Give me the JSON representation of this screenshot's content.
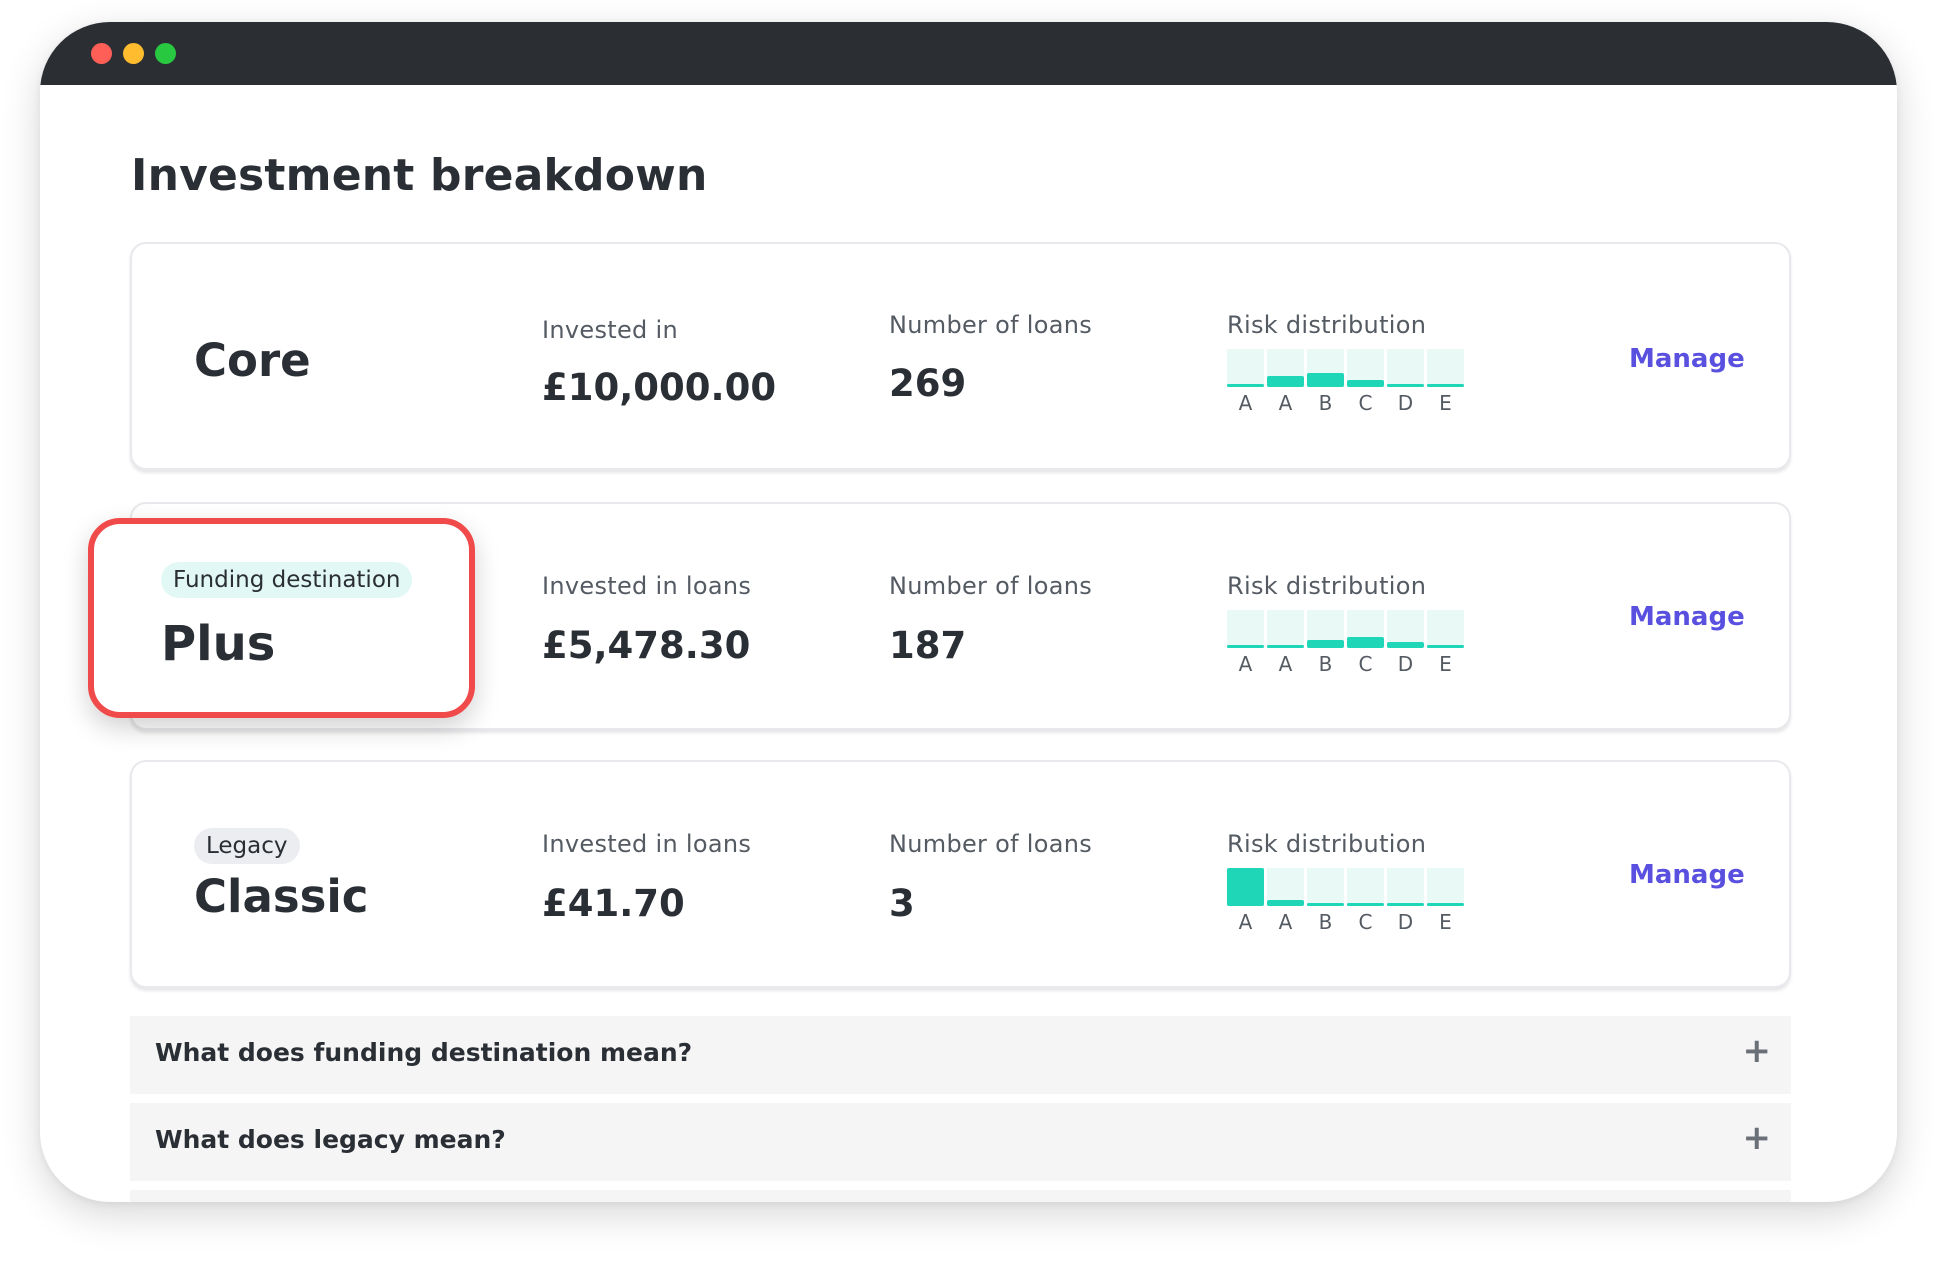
{
  "window": {
    "controls": [
      {
        "name": "close",
        "color": "#ff5f57"
      },
      {
        "name": "minimize",
        "color": "#febc2e"
      },
      {
        "name": "maximize",
        "color": "#28c840"
      }
    ]
  },
  "page": {
    "title": "Investment breakdown"
  },
  "risk_letters": [
    "A",
    "A",
    "B",
    "C",
    "D",
    "E"
  ],
  "accent_color": "#1fd6b7",
  "link_color": "#5a50e0",
  "highlight_color": "#f14a4a",
  "products": [
    {
      "name": "Core",
      "badge": "",
      "invested_label": "Invested in",
      "invested_value": "£10,000.00",
      "loans_label": "Number of loans",
      "loans_value": "269",
      "risk_title": "Risk distribution",
      "risk_levels": [
        0.05,
        0.28,
        0.36,
        0.18,
        0.0,
        0.05
      ],
      "manage_label": "Manage"
    },
    {
      "name": "Plus",
      "badge": "Funding destination",
      "invested_label": "Invested in loans",
      "invested_value": "£5,478.30",
      "loans_label": "Number of loans",
      "loans_value": "187",
      "risk_title": "Risk distribution",
      "risk_levels": [
        0.05,
        0.08,
        0.2,
        0.3,
        0.15,
        0.05
      ],
      "manage_label": "Manage"
    },
    {
      "name": "Classic",
      "badge": "Legacy",
      "invested_label": "Invested in loans",
      "invested_value": "£41.70",
      "loans_label": "Number of loans",
      "loans_value": "3",
      "risk_title": "Risk distribution",
      "risk_levels": [
        1.0,
        0.15,
        0.0,
        0.0,
        0.0,
        0.0
      ],
      "manage_label": "Manage"
    }
  ],
  "faq": [
    {
      "question": "What does funding destination mean?",
      "icon": "plus-icon"
    },
    {
      "question": "What does legacy mean?",
      "icon": "plus-icon"
    }
  ]
}
